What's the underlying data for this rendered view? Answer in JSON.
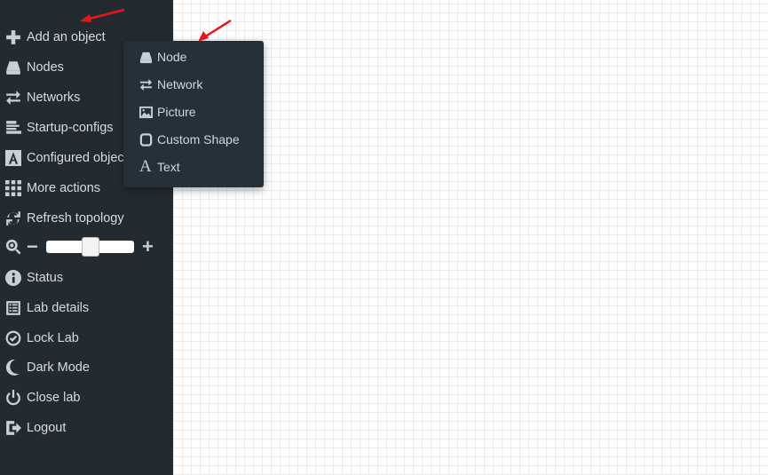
{
  "sidebar": {
    "items": [
      {
        "label": "Add an object",
        "icon": "plus-icon"
      },
      {
        "label": "Nodes",
        "icon": "hdd-icon"
      },
      {
        "label": "Networks",
        "icon": "exchange-icon"
      },
      {
        "label": "Startup-configs",
        "icon": "align-left-icon"
      },
      {
        "label": "Configured objects",
        "icon": "font-icon"
      },
      {
        "label": "More actions",
        "icon": "grid-icon"
      },
      {
        "label": "Refresh topology",
        "icon": "refresh-icon"
      },
      {
        "label": "Status",
        "icon": "info-icon"
      },
      {
        "label": "Lab details",
        "icon": "list-icon"
      },
      {
        "label": "Lock Lab",
        "icon": "check-circle-icon"
      },
      {
        "label": "Dark Mode",
        "icon": "moon-icon"
      },
      {
        "label": "Close lab",
        "icon": "power-icon"
      },
      {
        "label": "Logout",
        "icon": "sign-out-icon"
      }
    ],
    "zoom": {
      "minus": "−",
      "plus": "+",
      "level_fraction": 0.5
    }
  },
  "add_menu": {
    "items": [
      {
        "label": "Node",
        "icon": "hdd-icon"
      },
      {
        "label": "Network",
        "icon": "exchange-icon"
      },
      {
        "label": "Picture",
        "icon": "picture-icon"
      },
      {
        "label": "Custom Shape",
        "icon": "square-icon"
      },
      {
        "label": "Text",
        "icon": "font-icon"
      }
    ]
  },
  "colors": {
    "sidebar": "#232b31",
    "menu": "#263038",
    "arrow": "#e8161b"
  }
}
